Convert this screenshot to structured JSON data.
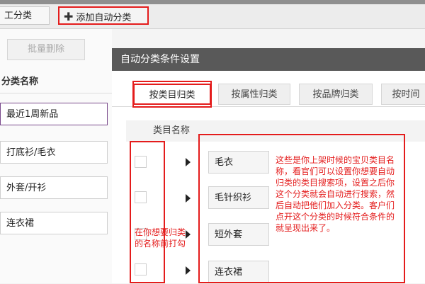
{
  "toolbar": {
    "first_button_label": "工分类",
    "add_auto_label": "添加自动分类"
  },
  "left_panel": {
    "batch_delete_label": "批量删除",
    "header": "分类名称",
    "categories": [
      "最近1周新品",
      "打底衫/毛衣",
      "外套/开衫",
      "连衣裙"
    ]
  },
  "dialog": {
    "title": "自动分类条件设置",
    "tabs": [
      "按类目归类",
      "按属性归类",
      "按品牌归类",
      "按时间"
    ],
    "column_header": "类目名称",
    "rows": [
      "毛衣",
      "毛针织衫",
      "短外套",
      "连衣裙"
    ]
  },
  "annotations": {
    "right_note": "这些是你上架时候的宝贝类目名称，看官们可以设置你想要自动归类的类目搜索项，设置之后你这个分类就会自动进行搜索，然后自动把他们加入分类。客户们点开这个分类的时候符合条件的就呈现出来了。",
    "left_note": "在你想要归类的名称前打勾"
  },
  "colors": {
    "highlight_red": "#e41c1c",
    "dialog_title_bg": "#595959"
  }
}
